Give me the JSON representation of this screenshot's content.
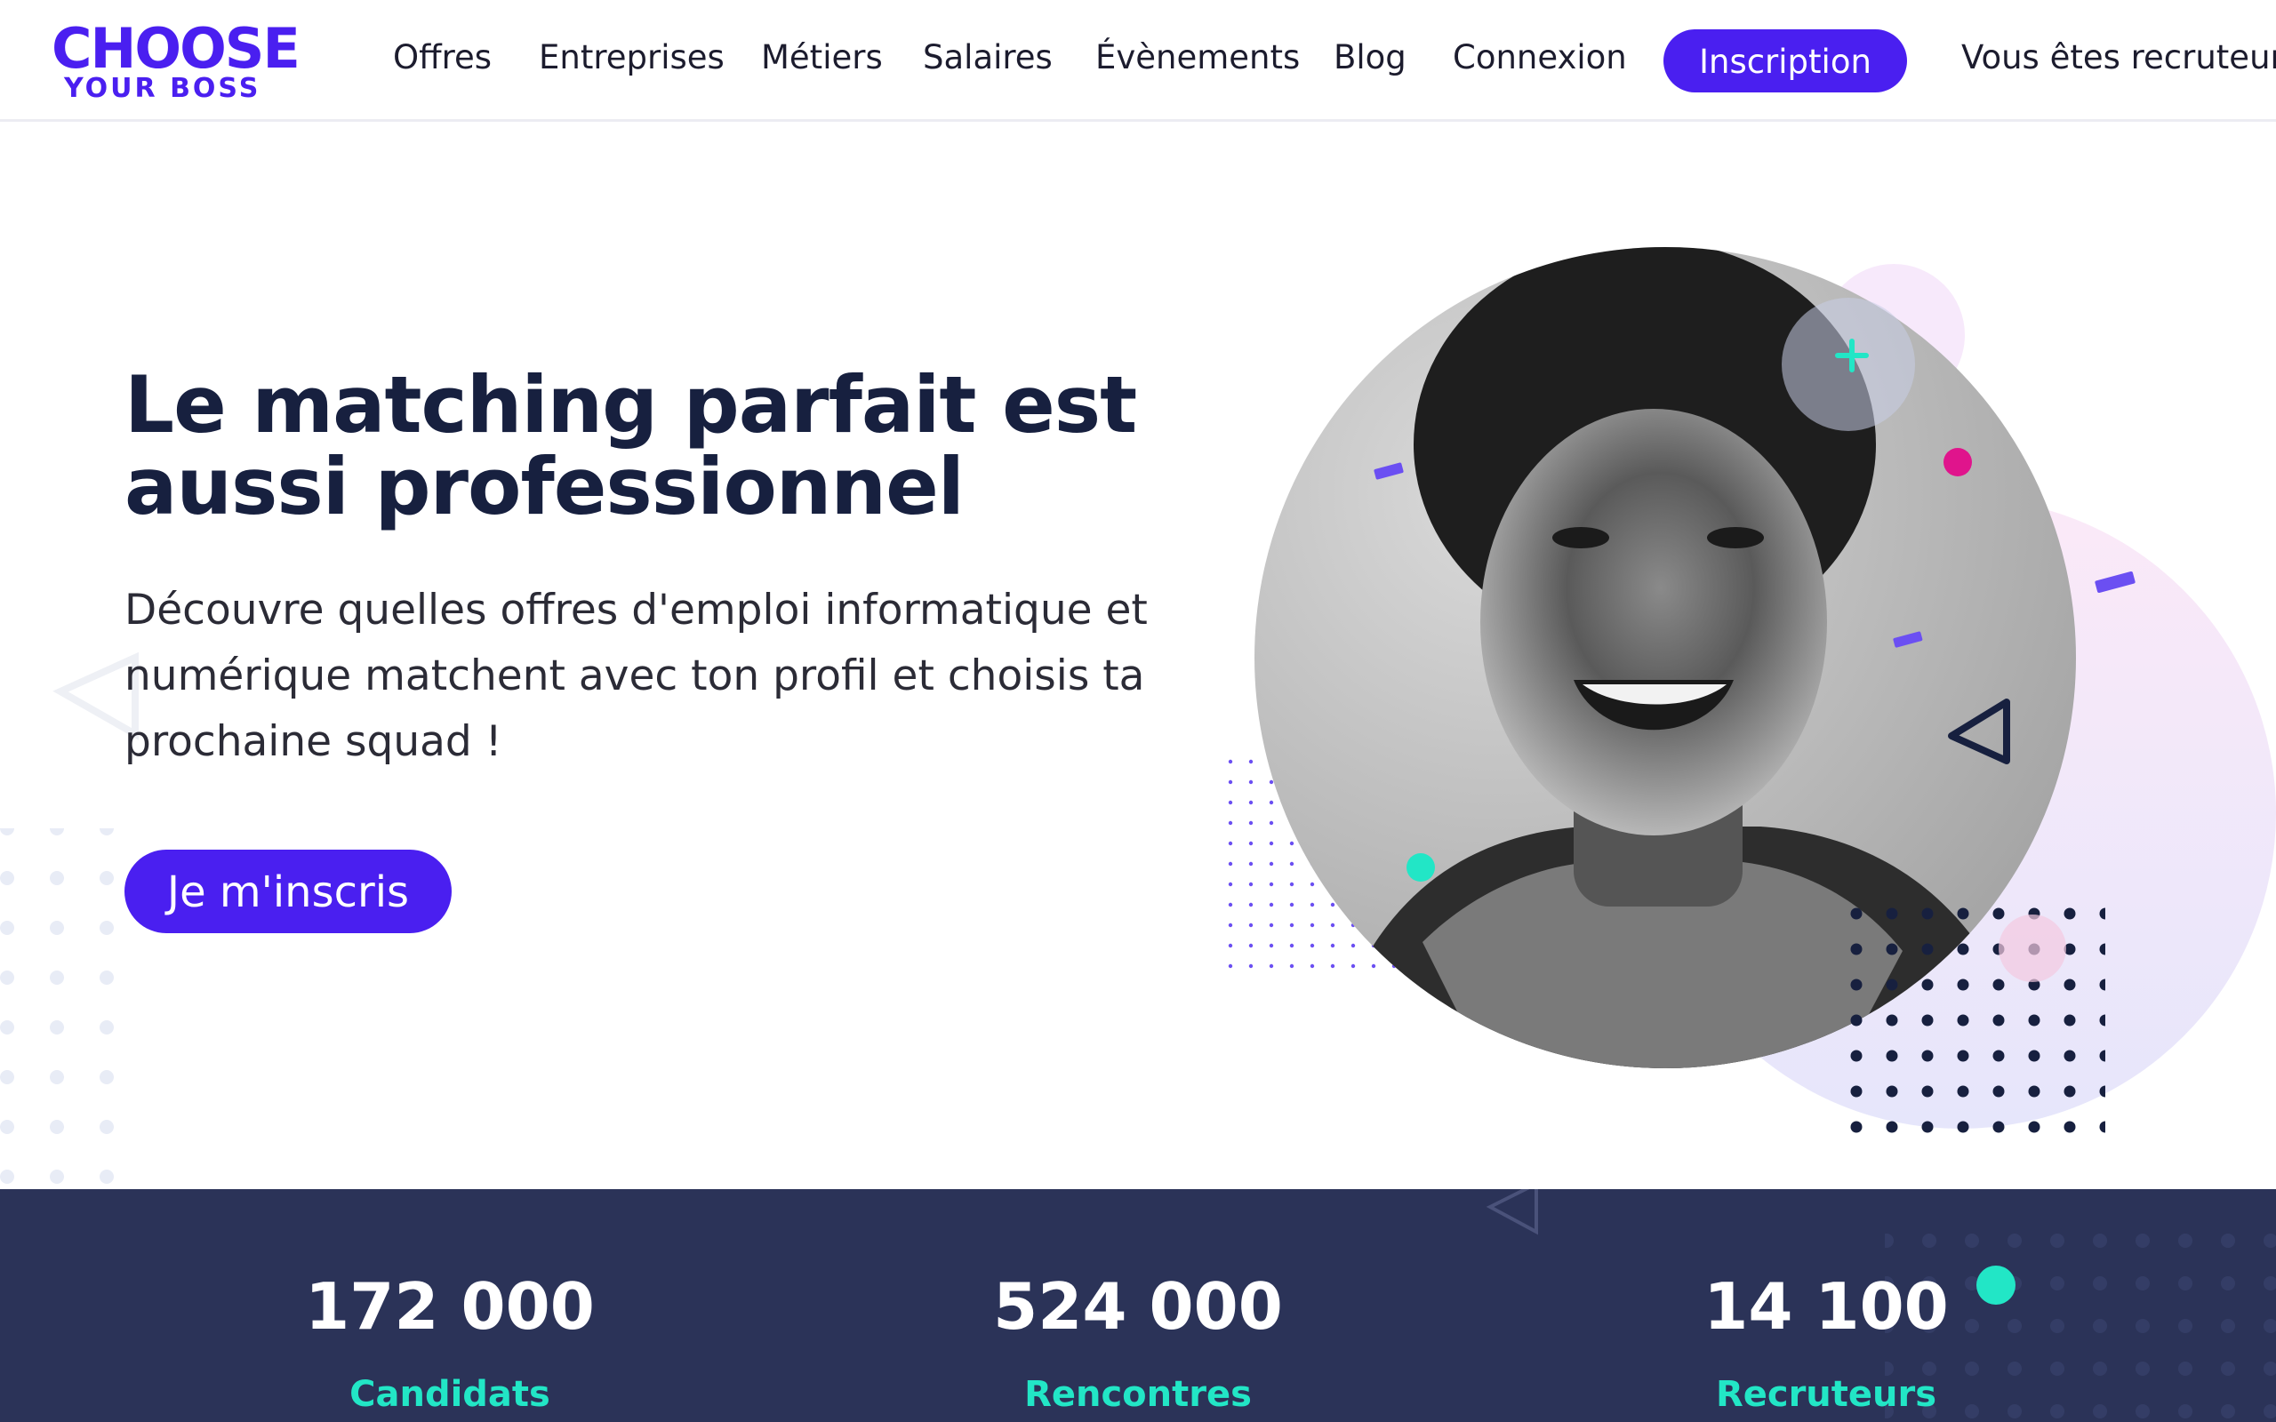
{
  "brand": {
    "logo_top": "CHOOSE",
    "logo_bottom": "YOUR BOSS",
    "accent_color": "#4a1ff0",
    "navy_color": "#17203f",
    "teal_color": "#22e6c6",
    "pink_color": "#e0148c"
  },
  "nav": {
    "items": [
      {
        "label": "Offres"
      },
      {
        "label": "Entreprises"
      },
      {
        "label": "Métiers"
      },
      {
        "label": "Salaires"
      },
      {
        "label": "Évènements"
      },
      {
        "label": "Blog"
      },
      {
        "label": "Connexion"
      }
    ],
    "signup_label": "Inscription",
    "recruiter_label": "Vous êtes recruteur"
  },
  "hero": {
    "title": "Le matching parfait est aussi professionnel",
    "text": "Découvre quelles offres d'emploi informatique et numérique matchent avec ton profil et choisis ta prochaine squad !",
    "cta_label": "Je m'inscris",
    "image": "portrait-photo"
  },
  "stats": [
    {
      "value": "172 000",
      "label": "Candidats"
    },
    {
      "value": "524 000",
      "label": "Rencontres"
    },
    {
      "value": "14 100",
      "label": "Recruteurs"
    }
  ]
}
